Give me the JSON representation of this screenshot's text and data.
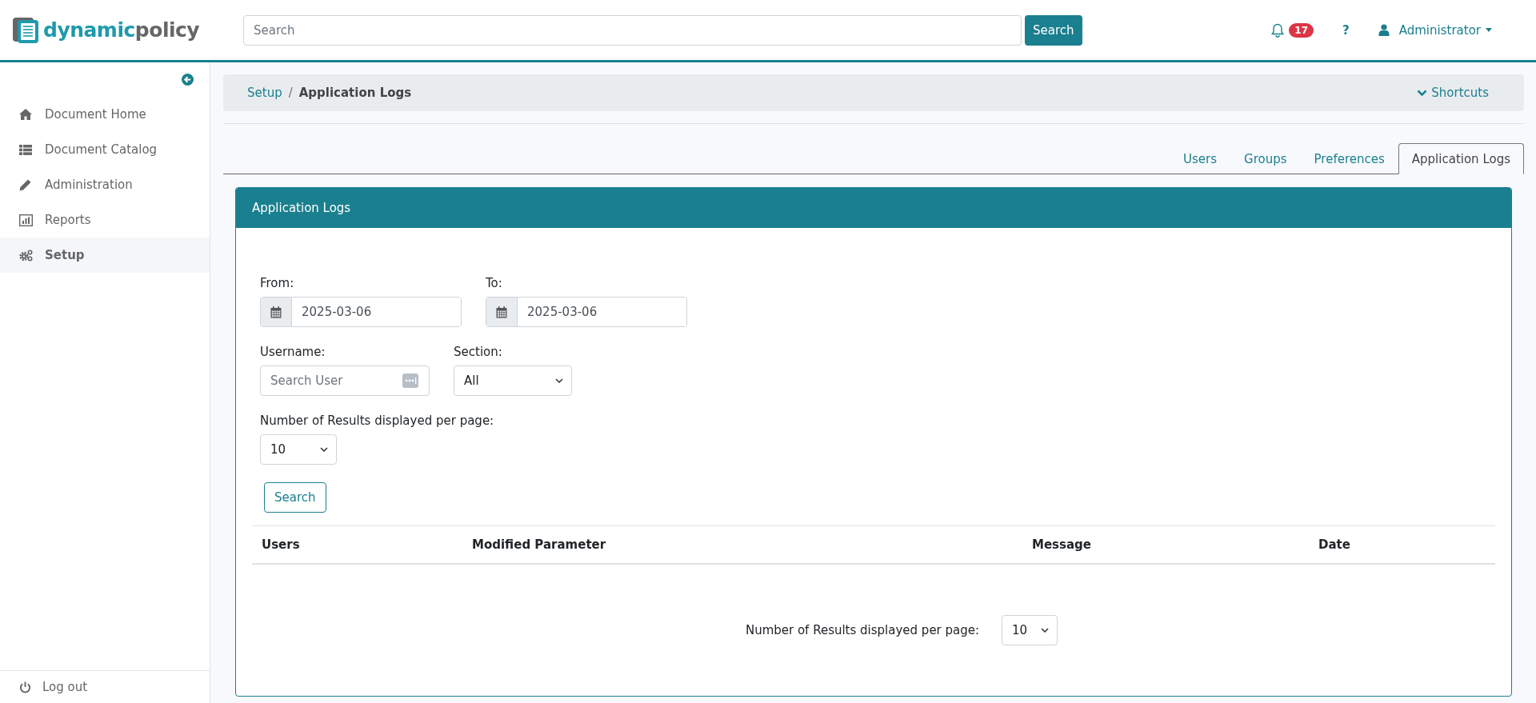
{
  "header": {
    "logo": {
      "part_1": "dynamic",
      "part_2": "policy"
    },
    "search": {
      "placeholder": "Search",
      "button": "Search"
    },
    "notifications": {
      "count": "17"
    },
    "help": "?",
    "user": "Administrator"
  },
  "sidebar": {
    "items": [
      {
        "label": "Document Home",
        "kind": "home",
        "selected": false
      },
      {
        "label": "Document Catalog",
        "kind": "list",
        "selected": false
      },
      {
        "label": "Administration",
        "kind": "pencil",
        "selected": false
      },
      {
        "label": "Reports",
        "kind": "chart",
        "selected": false
      },
      {
        "label": "Setup",
        "kind": "gears",
        "selected": true
      }
    ],
    "logout": "Log out"
  },
  "breadcrumb": {
    "items": [
      "Setup",
      "Application Logs"
    ],
    "separator": "/",
    "shortcuts": "Shortcuts"
  },
  "tabs": [
    {
      "label": "Users",
      "selected": false
    },
    {
      "label": "Groups",
      "selected": false
    },
    {
      "label": "Preferences",
      "selected": false
    },
    {
      "label": "Application Logs",
      "selected": true
    }
  ],
  "panel": {
    "title": "Application Logs",
    "from": {
      "label": "From:",
      "value": "2025-03-06"
    },
    "to": {
      "label": "To:",
      "value": "2025-03-06"
    },
    "username": {
      "label": "Username:",
      "placeholder": "Search User"
    },
    "section": {
      "label": "Section:",
      "value": "All"
    },
    "per_page": {
      "label": "Number of Results displayed per page:",
      "value": "10"
    },
    "search_button": "Search",
    "table": {
      "columns": [
        "Users",
        "Modified Parameter",
        "Message",
        "Date"
      ]
    },
    "footer": {
      "label": "Number of Results displayed per page:",
      "value": "10"
    }
  }
}
